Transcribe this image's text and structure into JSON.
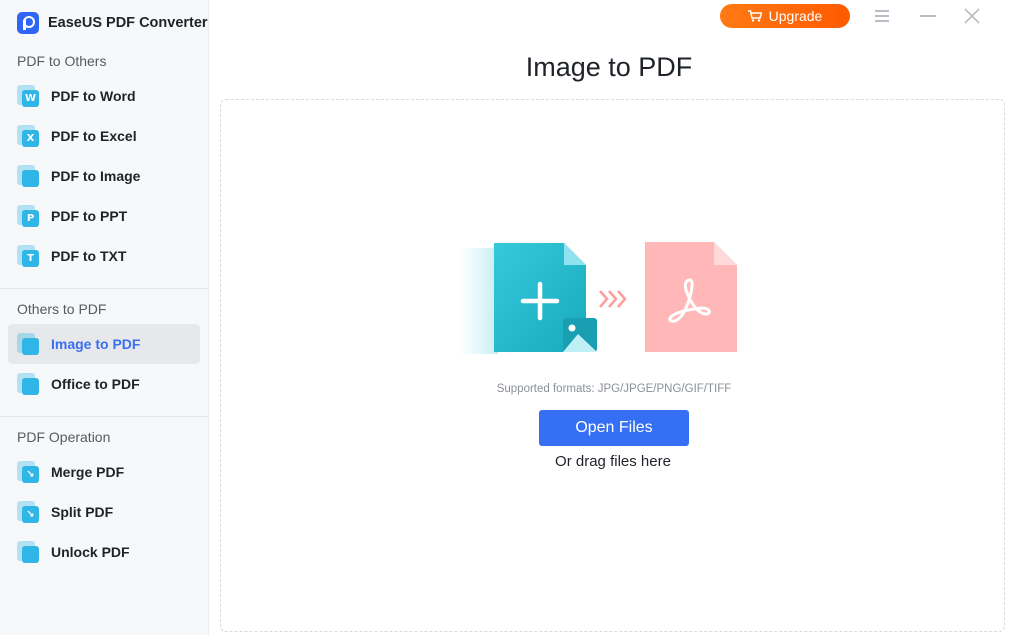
{
  "app": {
    "title": "EaseUS PDF Converter"
  },
  "sidebar": {
    "sections": [
      {
        "title": "PDF to Others",
        "items": [
          {
            "label": "PDF to Word",
            "icon": "word-icon",
            "glyph": "W",
            "color": "#2fb6e6"
          },
          {
            "label": "PDF to Excel",
            "icon": "excel-icon",
            "glyph": "X",
            "color": "#2fb6e6"
          },
          {
            "label": "PDF to Image",
            "icon": "image-icon",
            "glyph": "",
            "color": "#2fb6e6"
          },
          {
            "label": "PDF to PPT",
            "icon": "ppt-icon",
            "glyph": "P",
            "color": "#2fb6e6"
          },
          {
            "label": "PDF to TXT",
            "icon": "txt-icon",
            "glyph": "T",
            "color": "#2fb6e6"
          }
        ]
      },
      {
        "title": "Others to PDF",
        "items": [
          {
            "label": "Image to PDF",
            "icon": "image-to-pdf-icon",
            "glyph": "",
            "color": "#2fb6e6",
            "active": true
          },
          {
            "label": "Office to PDF",
            "icon": "office-icon",
            "glyph": "",
            "color": "#2fb6e6"
          }
        ]
      },
      {
        "title": "PDF Operation",
        "items": [
          {
            "label": "Merge PDF",
            "icon": "merge-icon",
            "glyph": "↘",
            "color": "#2fb6e6"
          },
          {
            "label": "Split PDF",
            "icon": "split-icon",
            "glyph": "↘",
            "color": "#2fb6e6"
          },
          {
            "label": "Unlock PDF",
            "icon": "unlock-icon",
            "glyph": "",
            "color": "#2fb6e6"
          }
        ]
      }
    ]
  },
  "topbar": {
    "upgrade_label": "Upgrade"
  },
  "main": {
    "title": "Image to PDF",
    "formats": "Supported formats: JPG/JPGE/PNG/GIF/TIFF",
    "open_label": "Open Files",
    "drag_label": "Or drag files here"
  },
  "colors": {
    "accent": "#3570f4",
    "upgrade": "#ff6a00",
    "active_text": "#3a6ff0",
    "pdf": "#ffb3b3",
    "image_doc": "#26b9cc"
  }
}
